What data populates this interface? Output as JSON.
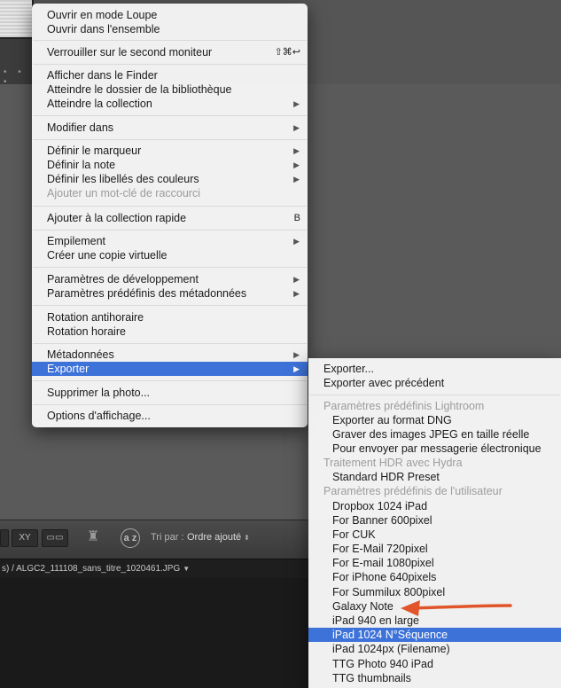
{
  "context_menu": {
    "items": [
      {
        "label": "Ouvrir en mode Loupe"
      },
      {
        "label": "Ouvrir dans l'ensemble"
      },
      {
        "label": "Verrouiller sur le second moniteur",
        "shortcut": "⇧⌘↩"
      },
      {
        "label": "Afficher dans le Finder"
      },
      {
        "label": "Atteindre le dossier de la bibliothèque"
      },
      {
        "label": "Atteindre la collection"
      },
      {
        "label": "Modifier dans"
      },
      {
        "label": "Définir le marqueur"
      },
      {
        "label": "Définir la note"
      },
      {
        "label": "Définir les libellés des couleurs"
      },
      {
        "label": "Ajouter un mot-clé de raccourci"
      },
      {
        "label": "Ajouter à la collection rapide",
        "shortcut": "B"
      },
      {
        "label": "Empilement"
      },
      {
        "label": "Créer une copie virtuelle"
      },
      {
        "label": "Paramètres de développement"
      },
      {
        "label": "Paramètres prédéfinis des métadonnées"
      },
      {
        "label": "Rotation antihoraire"
      },
      {
        "label": "Rotation horaire"
      },
      {
        "label": "Métadonnées"
      },
      {
        "label": "Exporter"
      },
      {
        "label": "Supprimer la photo..."
      },
      {
        "label": "Options d'affichage..."
      }
    ]
  },
  "export_submenu": {
    "items": [
      {
        "label": "Exporter..."
      },
      {
        "label": "Exporter avec précédent"
      },
      {
        "label": "Paramètres prédéfinis Lightroom"
      },
      {
        "label": "Exporter au format DNG"
      },
      {
        "label": "Graver des images JPEG en taille réelle"
      },
      {
        "label": "Pour envoyer par messagerie électronique"
      },
      {
        "label": "Traitement HDR avec Hydra"
      },
      {
        "label": "Standard HDR Preset"
      },
      {
        "label": "Paramètres prédéfinis de l'utilisateur"
      },
      {
        "label": "Dropbox 1024 iPad"
      },
      {
        "label": "For Banner 600pixel"
      },
      {
        "label": "For CUK"
      },
      {
        "label": "For E-Mail 720pixel"
      },
      {
        "label": "For E-mail 1080pixel"
      },
      {
        "label": "For iPhone 640pixels"
      },
      {
        "label": "For Summilux 800pixel"
      },
      {
        "label": "Galaxy Note"
      },
      {
        "label": "iPad 940 en large"
      },
      {
        "label": "iPad 1024 N°Séquence"
      },
      {
        "label": "iPad 1024px (Filename)"
      },
      {
        "label": "TTG Photo 940 iPad"
      },
      {
        "label": "TTG thumbnails"
      }
    ]
  },
  "toolbar": {
    "sort_label": "Tri par :",
    "sort_value": "Ordre ajouté",
    "sort_icon_text": "a z",
    "xy_label": "XY"
  },
  "path_bar": {
    "text": "s) / ALGC2_111108_sans_titre_1020461.JPG"
  },
  "colors": {
    "menu_highlight": "#3d72d9",
    "annotation_arrow": "#e0552a"
  }
}
